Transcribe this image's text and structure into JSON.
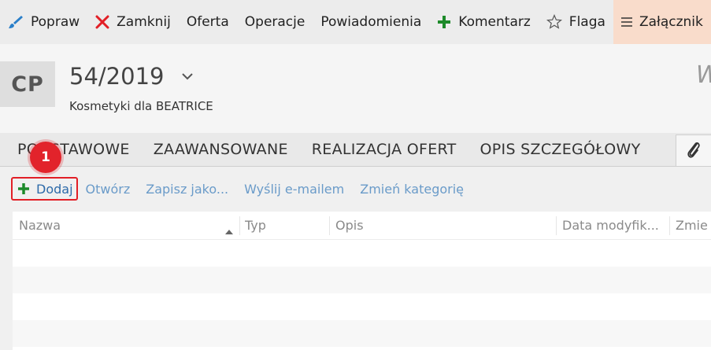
{
  "toolbar": {
    "items": [
      {
        "label": "Popraw",
        "icon": "brush-icon"
      },
      {
        "label": "Zamknij",
        "icon": "close-icon"
      },
      {
        "label": "Oferta"
      },
      {
        "label": "Operacje"
      },
      {
        "label": "Powiadomienia"
      },
      {
        "label": "Komentarz",
        "icon": "plus-icon"
      },
      {
        "label": "Flaga",
        "icon": "star-outline-icon"
      },
      {
        "label": "Załącznik",
        "icon": "menu-icon"
      }
    ]
  },
  "header": {
    "avatar_initials": "CP",
    "record_number": "54/2019",
    "subtitle": "Kosmetyki dla BEATRICE",
    "right_truncated": "W"
  },
  "tabs": [
    "PODSTAWOWE",
    "ZAAWANSOWANE",
    "REALIZACJA OFERT",
    "OPIS SZCZEGÓŁOWY"
  ],
  "actions": {
    "add": "Dodaj",
    "open": "Otwórz",
    "save_as": "Zapisz jako...",
    "send_email": "Wyślij e-mailem",
    "change_category": "Zmień kategorię"
  },
  "badge": "1",
  "grid": {
    "columns": [
      "Nazwa",
      "Typ",
      "Opis",
      "Data modyfik...",
      "Zmie"
    ]
  },
  "colors": {
    "accent_red": "#e2232b",
    "link_blue": "#6a9bc9",
    "active_tab_bg": "#f9dccb",
    "plus_green": "#1d8a2a"
  }
}
